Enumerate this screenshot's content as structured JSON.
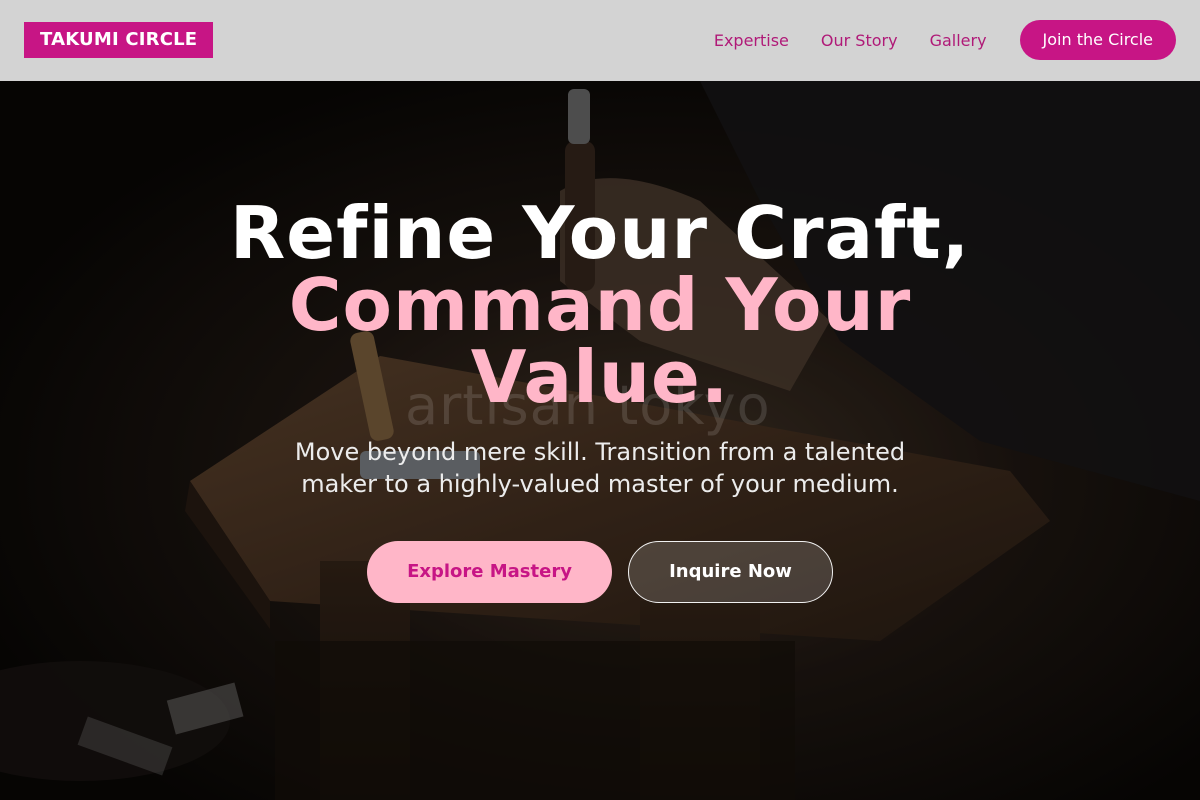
{
  "header": {
    "logo": "TAKUMI CIRCLE",
    "nav": [
      {
        "label": "Expertise"
      },
      {
        "label": "Our Story"
      },
      {
        "label": "Gallery"
      }
    ],
    "cta": "Join the Circle"
  },
  "hero": {
    "headline_line1": "Refine Your Craft,",
    "headline_line2": "Command Your",
    "headline_line3": "Value.",
    "subtext": "Move beyond mere skill. Transition from a talented maker to a highly-valued master of your medium.",
    "primary_button": "Explore Mastery",
    "secondary_button": "Inquire Now",
    "image_watermark": "artisan tokyo"
  },
  "colors": {
    "brand": "#c71585",
    "accent": "#ffb6c8",
    "header_bg": "#d3d3d3"
  }
}
